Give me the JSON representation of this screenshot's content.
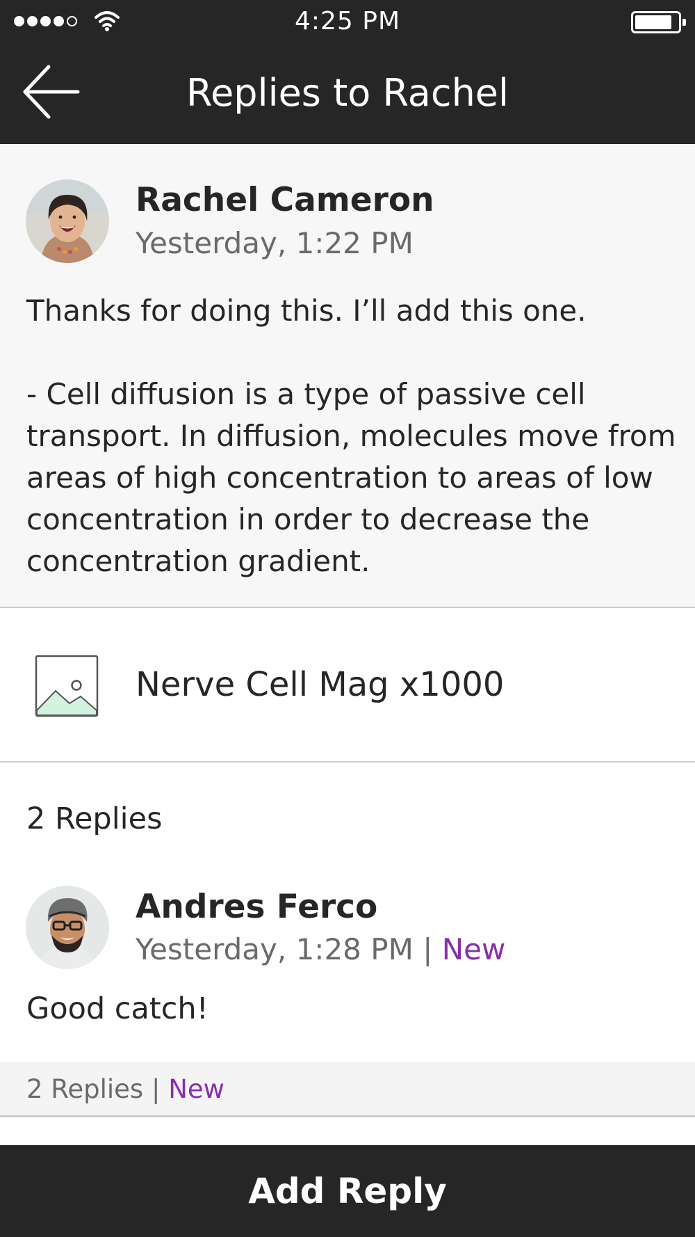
{
  "status_bar": {
    "time": "4:25 PM",
    "signal_icon": "cellular-signal-icon",
    "wifi_icon": "wifi-icon",
    "battery_icon": "battery-icon"
  },
  "nav": {
    "back_icon": "arrow-left-icon",
    "title": "Replies to Rachel"
  },
  "post": {
    "author": "Rachel Cameron",
    "timestamp": "Yesterday, 1:22 PM",
    "body": "Thanks for doing this. I’ll add this one.\n\n- Cell diffusion is a type of passive cell transport. In diffusion, molecules move from areas of high concentration to areas of low concentration in order to decrease the concentration gradient."
  },
  "attachment": {
    "icon": "image-icon",
    "label": "Nerve Cell Mag x1000"
  },
  "replies": {
    "header": "2 Replies",
    "items": [
      {
        "author": "Andres Ferco",
        "timestamp": "Yesterday, 1:28 PM",
        "separator": "|",
        "new_label": "New",
        "body": "Good catch!",
        "footer_count": "2 Replies",
        "footer_separator": "|",
        "footer_new": "New"
      }
    ]
  },
  "add_reply_label": "Add Reply",
  "colors": {
    "bar_background": "#262626",
    "accent_purple": "#8a2da8",
    "post_background": "#f7f7f7"
  }
}
